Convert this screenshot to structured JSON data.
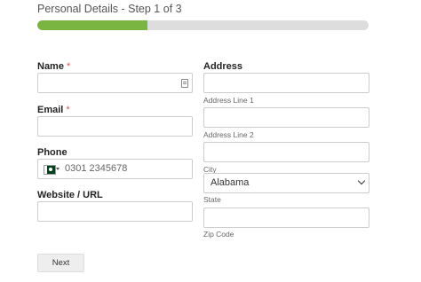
{
  "step": {
    "title": "Personal Details - Step 1 of 3",
    "progress_fraction": 0.333,
    "progress_color": "#7ab441"
  },
  "fields": {
    "name": {
      "label": "Name",
      "required_mark": "*",
      "value": "",
      "icon": "contact-card-icon"
    },
    "email": {
      "label": "Email",
      "required_mark": "*",
      "value": ""
    },
    "phone": {
      "label": "Phone",
      "country_flag": "pakistan-flag-icon",
      "value": "0301 2345678"
    },
    "website": {
      "label": "Website / URL",
      "value": ""
    }
  },
  "address": {
    "label": "Address",
    "line1": {
      "value": "",
      "sublabel": "Address Line 1"
    },
    "line2": {
      "value": "",
      "sublabel": "Address Line 2"
    },
    "city": {
      "value": "",
      "sublabel": "City"
    },
    "state": {
      "selected": "Alabama",
      "sublabel": "State"
    },
    "zip": {
      "value": "",
      "sublabel": "Zip Code"
    }
  },
  "actions": {
    "next_label": "Next"
  }
}
